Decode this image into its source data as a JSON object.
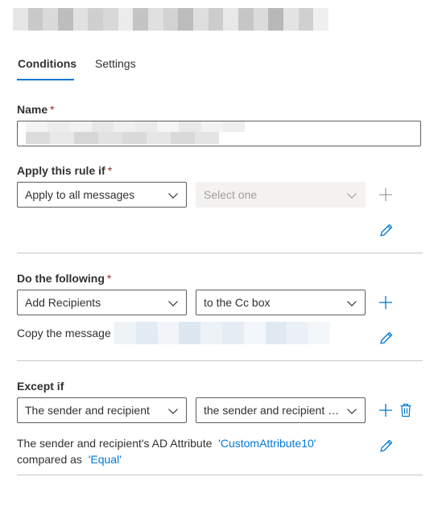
{
  "colors": {
    "accent": "#0078d4",
    "required": "#a4262c",
    "border": "#605e5c",
    "disabled_bg": "#f3f2f1",
    "divider": "#c8c6c4"
  },
  "tabs": [
    {
      "label": "Conditions",
      "active": true
    },
    {
      "label": "Settings",
      "active": false
    }
  ],
  "name_field": {
    "label": "Name",
    "required_mark": "*"
  },
  "apply_section": {
    "label": "Apply this rule if",
    "required_mark": "*",
    "primary_dropdown": "Apply to all messages",
    "secondary_dropdown": "Select one",
    "icons": [
      "plus-icon",
      "pencil-icon"
    ]
  },
  "do_section": {
    "label": "Do the following",
    "required_mark": "*",
    "primary_dropdown": "Add Recipients",
    "secondary_dropdown": "to the Cc box",
    "description_prefix": "Copy the message t",
    "icons": [
      "plus-icon",
      "pencil-icon"
    ]
  },
  "except_section": {
    "label": "Except if",
    "primary_dropdown": "The sender and recipient",
    "secondary_dropdown": "the sender and recipient p...",
    "description_line1_text": "The sender and recipient's AD Attribute",
    "description_line1_link": "'CustomAttribute10'",
    "description_line2_text": "compared as",
    "description_line2_link": "'Equal'",
    "icons": [
      "plus-icon",
      "trash-icon",
      "pencil-icon"
    ]
  }
}
